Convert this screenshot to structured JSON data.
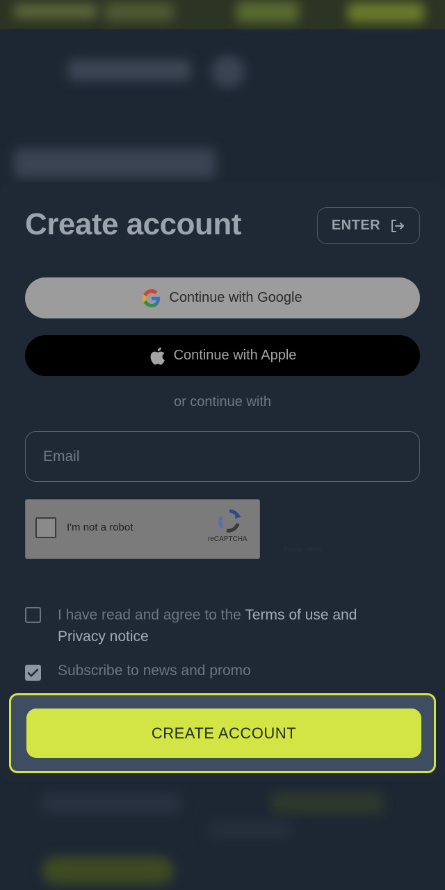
{
  "modal": {
    "title": "Create account",
    "enter_label": "ENTER"
  },
  "social": {
    "google_label": "Continue with Google",
    "apple_label": "Continue with Apple"
  },
  "divider_text": "or continue with",
  "email": {
    "placeholder": "Email",
    "value": ""
  },
  "recaptcha": {
    "label": "I'm not a robot",
    "brand": "reCAPTCHA",
    "links": "Privacy - Terms",
    "checked": false
  },
  "agreements": {
    "terms_prefix": "I have read and agree to the ",
    "terms_link": "Terms of use and Privacy notice",
    "terms_checked": false,
    "subscribe_label": "Subscribe to news and promo",
    "subscribe_checked": true
  },
  "cta_label": "CREATE ACCOUNT",
  "colors": {
    "accent": "#d3e544",
    "modal_bg": "#1f2936"
  }
}
